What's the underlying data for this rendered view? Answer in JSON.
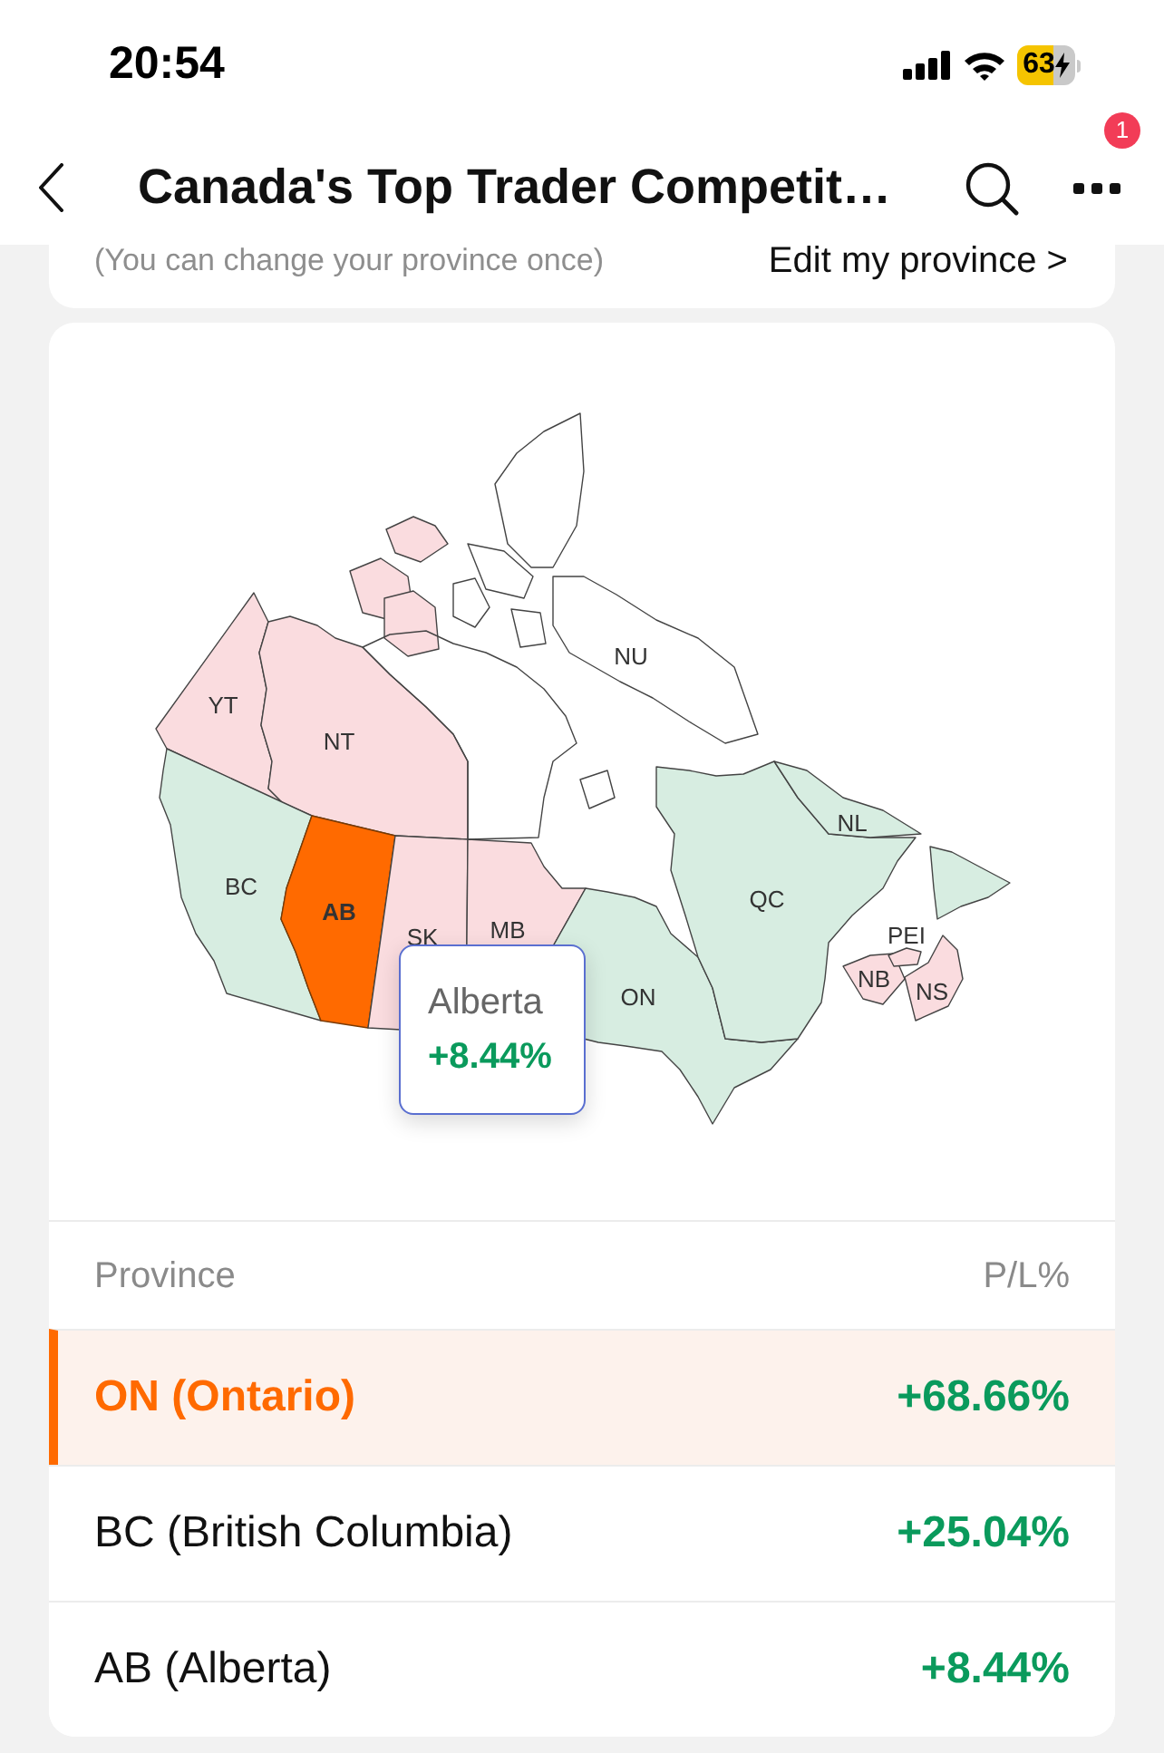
{
  "status_bar": {
    "time": "20:54",
    "battery": "63"
  },
  "nav": {
    "title": "Canada's Top Trader Competit…",
    "badge": "1"
  },
  "province_note": {
    "hint": "(You can change your province once)",
    "link": "Edit my province >"
  },
  "map": {
    "regions": [
      {
        "label": "YT",
        "color": "#fadcdf",
        "selected": false
      },
      {
        "label": "NT",
        "color": "#fadcdf",
        "selected": false
      },
      {
        "label": "NU",
        "selected": false
      },
      {
        "label": "BC",
        "color": "#d7ede1",
        "selected": false
      },
      {
        "label": "AB",
        "color": "#ff6a00",
        "selected": true
      },
      {
        "label": "SK",
        "color": "#fadcdf",
        "selected": false
      },
      {
        "label": "MB",
        "color": "#fadcdf",
        "selected": false
      },
      {
        "label": "ON",
        "color": "#d7ede1",
        "selected": false
      },
      {
        "label": "QC",
        "color": "#d7ede1",
        "selected": false
      },
      {
        "label": "NL",
        "color": "#d7ede1",
        "selected": false
      },
      {
        "label": "NB",
        "color": "#fadcdf",
        "selected": false
      },
      {
        "label": "PEI",
        "color": "#fadcdf",
        "selected": false
      },
      {
        "label": "NS",
        "color": "#fadcdf",
        "selected": false
      }
    ],
    "tooltip": {
      "title": "Alberta",
      "value": "+8.44%"
    }
  },
  "table": {
    "columns": [
      "Province",
      "P/L%"
    ],
    "rows": [
      {
        "province": "ON (Ontario)",
        "pl": "+68.66%",
        "selected": true
      },
      {
        "province": "BC (British Columbia)",
        "pl": "+25.04%",
        "selected": false
      },
      {
        "province": "AB (Alberta)",
        "pl": "+8.44%",
        "selected": false
      }
    ]
  }
}
